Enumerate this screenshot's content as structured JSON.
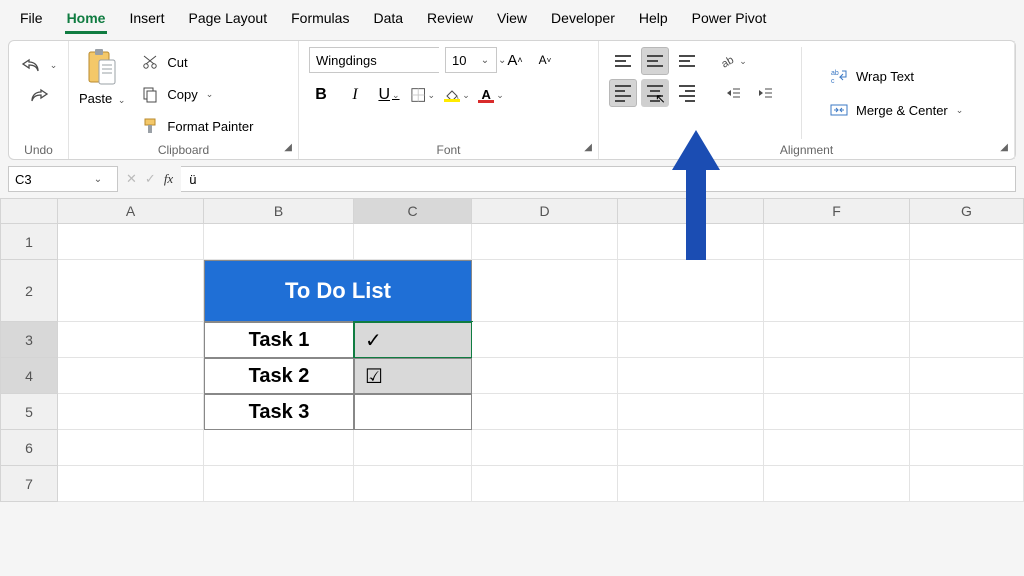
{
  "menu": {
    "items": [
      "File",
      "Home",
      "Insert",
      "Page Layout",
      "Formulas",
      "Data",
      "Review",
      "View",
      "Developer",
      "Help",
      "Power Pivot"
    ],
    "active": "Home"
  },
  "ribbon": {
    "undo": {
      "label": "Undo"
    },
    "clipboard": {
      "label": "Clipboard",
      "paste": "Paste",
      "cut": "Cut",
      "copy": "Copy",
      "format_painter": "Format Painter"
    },
    "font": {
      "label": "Font",
      "name": "Wingdings",
      "size": "10",
      "bold": "B",
      "italic": "I",
      "underline": "U"
    },
    "alignment": {
      "label": "Alignment",
      "wrap": "Wrap Text",
      "merge": "Merge & Center"
    }
  },
  "fx": {
    "namebox": "C3",
    "formula": "ü"
  },
  "grid": {
    "cols": [
      "A",
      "B",
      "C",
      "D",
      "E",
      "F",
      "G"
    ],
    "rows": [
      "1",
      "2",
      "3",
      "4",
      "5",
      "6",
      "7"
    ],
    "todo_header": "To Do List",
    "tasks": [
      "Task 1",
      "Task 2",
      "Task 3"
    ],
    "checks": [
      "✓",
      "☑",
      ""
    ],
    "selected_cell": "C3"
  }
}
